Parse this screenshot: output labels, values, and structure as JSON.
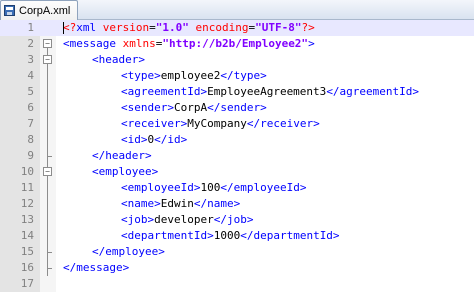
{
  "tab": {
    "title": "CorpA.xml",
    "icon": "save-icon"
  },
  "editor": {
    "colors": {
      "tag": "#0000ff",
      "attribute": "#ff0000",
      "value": "#8000ff",
      "text": "#000000",
      "gutter": "#e4e4e4",
      "current_line": "#e8e8ff"
    },
    "lines": [
      {
        "num": "1",
        "indent": 0,
        "tokens": [
          {
            "t": "decl",
            "v": "<?"
          },
          {
            "t": "tag",
            "v": "xml "
          },
          {
            "t": "attr",
            "v": "version"
          },
          {
            "t": "text",
            "v": "="
          },
          {
            "t": "val",
            "v": "\"1.0\""
          },
          {
            "t": "attr",
            "v": " encoding"
          },
          {
            "t": "text",
            "v": "="
          },
          {
            "t": "val",
            "v": "\"UTF-8\""
          },
          {
            "t": "decl",
            "v": "?>"
          }
        ]
      },
      {
        "num": "2",
        "indent": 0,
        "tokens": [
          {
            "t": "tag",
            "v": "<message "
          },
          {
            "t": "attr",
            "v": "xmlns"
          },
          {
            "t": "text",
            "v": "="
          },
          {
            "t": "val",
            "v": "\"http://b2b/Employee2\""
          },
          {
            "t": "tag",
            "v": ">"
          }
        ]
      },
      {
        "num": "3",
        "indent": 1,
        "tokens": [
          {
            "t": "tag",
            "v": "<header>"
          }
        ]
      },
      {
        "num": "4",
        "indent": 2,
        "tokens": [
          {
            "t": "tag",
            "v": "<type>"
          },
          {
            "t": "text",
            "v": "employee2"
          },
          {
            "t": "tag",
            "v": "</type>"
          }
        ]
      },
      {
        "num": "5",
        "indent": 2,
        "tokens": [
          {
            "t": "tag",
            "v": "<agreementId>"
          },
          {
            "t": "text",
            "v": "EmployeeAgreement3"
          },
          {
            "t": "tag",
            "v": "</agreementId>"
          }
        ]
      },
      {
        "num": "6",
        "indent": 2,
        "tokens": [
          {
            "t": "tag",
            "v": "<sender>"
          },
          {
            "t": "text",
            "v": "CorpA"
          },
          {
            "t": "tag",
            "v": "</sender>"
          }
        ]
      },
      {
        "num": "7",
        "indent": 2,
        "tokens": [
          {
            "t": "tag",
            "v": "<receiver>"
          },
          {
            "t": "text",
            "v": "MyCompany"
          },
          {
            "t": "tag",
            "v": "</receiver>"
          }
        ]
      },
      {
        "num": "8",
        "indent": 2,
        "tokens": [
          {
            "t": "tag",
            "v": "<id>"
          },
          {
            "t": "text",
            "v": "0"
          },
          {
            "t": "tag",
            "v": "</id>"
          }
        ]
      },
      {
        "num": "9",
        "indent": 1,
        "tokens": [
          {
            "t": "tag",
            "v": "</header>"
          }
        ]
      },
      {
        "num": "10",
        "indent": 1,
        "tokens": [
          {
            "t": "tag",
            "v": "<employee>"
          }
        ]
      },
      {
        "num": "11",
        "indent": 2,
        "tokens": [
          {
            "t": "tag",
            "v": "<employeeId>"
          },
          {
            "t": "text",
            "v": "100"
          },
          {
            "t": "tag",
            "v": "</employeeId>"
          }
        ]
      },
      {
        "num": "12",
        "indent": 2,
        "tokens": [
          {
            "t": "tag",
            "v": "<name>"
          },
          {
            "t": "text",
            "v": "Edwin"
          },
          {
            "t": "tag",
            "v": "</name>"
          }
        ]
      },
      {
        "num": "13",
        "indent": 2,
        "tokens": [
          {
            "t": "tag",
            "v": "<job>"
          },
          {
            "t": "text",
            "v": "developer"
          },
          {
            "t": "tag",
            "v": "</job>"
          }
        ]
      },
      {
        "num": "14",
        "indent": 2,
        "tokens": [
          {
            "t": "tag",
            "v": "<departmentId>"
          },
          {
            "t": "text",
            "v": "1000"
          },
          {
            "t": "tag",
            "v": "</departmentId>"
          }
        ]
      },
      {
        "num": "15",
        "indent": 1,
        "tokens": [
          {
            "t": "tag",
            "v": "</employee>"
          }
        ]
      },
      {
        "num": "16",
        "indent": 0,
        "tokens": [
          {
            "t": "tag",
            "v": "</message>"
          }
        ]
      },
      {
        "num": "17",
        "indent": 0,
        "tokens": []
      }
    ]
  }
}
